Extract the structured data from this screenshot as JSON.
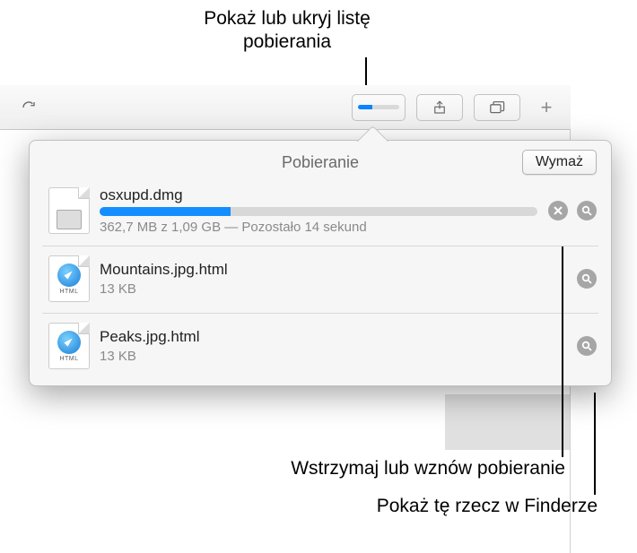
{
  "callouts": {
    "top": "Pokaż lub ukryj listę pobierania",
    "pause": "Wstrzymaj lub wznów pobieranie",
    "reveal": "Pokaż tę rzecz w Finderze"
  },
  "popover": {
    "title": "Pobieranie",
    "clear_label": "Wymaż"
  },
  "toolbar": {
    "download_progress_pct": 35
  },
  "downloads": [
    {
      "name": "osxupd.dmg",
      "status": "362,7 MB z 1,09 GB — Pozostało 14 sekund",
      "progress_pct": 30,
      "in_progress": true,
      "icon": "dmg"
    },
    {
      "name": "Mountains.jpg.html",
      "status": "13 KB",
      "in_progress": false,
      "icon": "html"
    },
    {
      "name": "Peaks.jpg.html",
      "status": "13 KB",
      "in_progress": false,
      "icon": "html"
    }
  ]
}
